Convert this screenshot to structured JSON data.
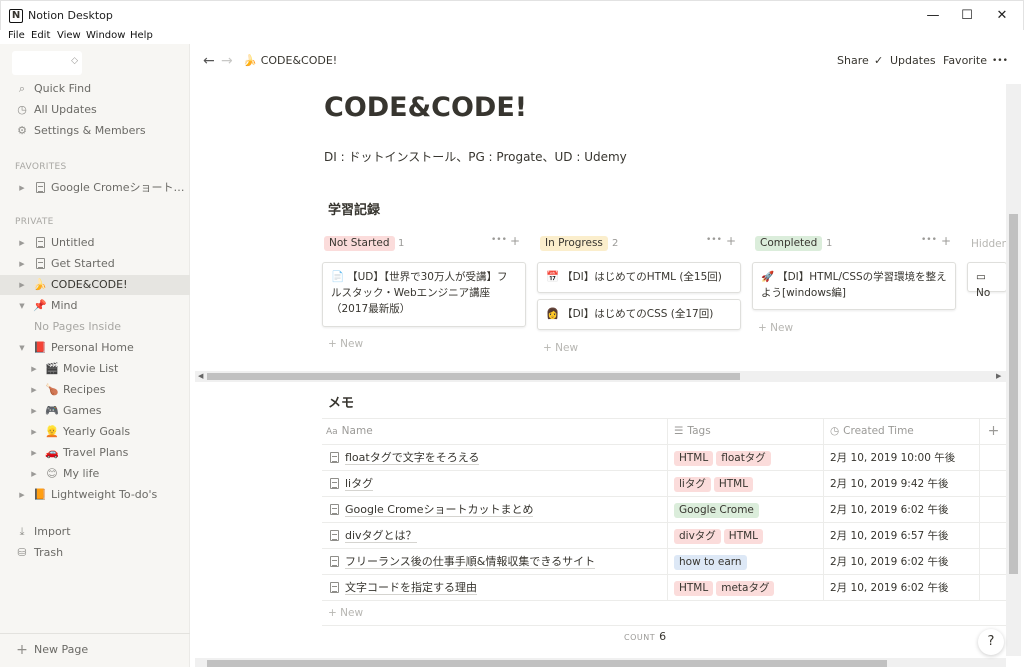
{
  "window": {
    "title": "Notion Desktop",
    "app_icon": "N",
    "minimize": "—",
    "maximize": "☐",
    "close": "✕"
  },
  "menu": [
    "File",
    "Edit",
    "View",
    "Window",
    "Help"
  ],
  "sidebar": {
    "quick": [
      {
        "label": "Quick Find",
        "icon": "search-icon",
        "glyph": "🔍"
      },
      {
        "label": "All Updates",
        "icon": "clock-icon",
        "glyph": "🕒"
      },
      {
        "label": "Settings & Members",
        "icon": "gear-icon",
        "glyph": "⚙"
      }
    ],
    "favorites_heading": "FAVORITES",
    "favorites": [
      {
        "label": "Google Cromeショート…",
        "icon": "page-icon"
      }
    ],
    "private_heading": "PRIVATE",
    "pages": [
      {
        "label": "Untitled",
        "icon": "page-icon"
      },
      {
        "label": "Get Started",
        "icon": "page-icon"
      },
      {
        "label": "CODE&CODE!",
        "icon": "banana-icon",
        "glyph": "🍌"
      },
      {
        "label": "Mind",
        "icon": "pushpin-icon",
        "glyph": "📌"
      },
      {
        "label": "No Pages Inside"
      },
      {
        "label": "Personal Home",
        "icon": "book-icon",
        "glyph": "📕"
      },
      {
        "label": "Movie List",
        "icon": "clapper-icon",
        "glyph": "🎬"
      },
      {
        "label": "Recipes",
        "icon": "drumstick-icon",
        "glyph": "🍗"
      },
      {
        "label": "Games",
        "icon": "gamepad-icon",
        "glyph": "🎮"
      },
      {
        "label": "Yearly Goals",
        "icon": "person-icon",
        "glyph": "👱"
      },
      {
        "label": "Travel Plans",
        "icon": "car-icon",
        "glyph": "🚗"
      },
      {
        "label": "My life",
        "icon": "smiley-icon",
        "glyph": "😊"
      },
      {
        "label": "Lightweight To-do's",
        "icon": "red-book-icon",
        "glyph": "📙"
      }
    ],
    "bottom": [
      {
        "label": "Import",
        "icon": "import-icon",
        "glyph": "⤓"
      },
      {
        "label": "Trash",
        "icon": "trash-icon",
        "glyph": "🗑"
      }
    ],
    "new_page": "New Page",
    "new_page_glyph": "+"
  },
  "topbar": {
    "back": "←",
    "forward": "→",
    "breadcrumb": "CODE&CODE!",
    "breadcrumb_glyph": "🍌",
    "share": "Share",
    "updates": "Updates",
    "updates_check": "✓",
    "favorite": "Favorite",
    "more": "•••"
  },
  "page": {
    "title": "CODE&CODE!",
    "description": "DI : ドットインストール、PG : Progate、UD : Udemy"
  },
  "board": {
    "title": "学習記録",
    "columns": [
      {
        "label": "Not Started",
        "count": "1",
        "color": "#fbdcdb",
        "cards": [
          {
            "glyph": "📄",
            "text": "【UD】【世界で30万人が受講】フルスタック・Webエンジニア講座（2017最新版）"
          }
        ]
      },
      {
        "label": "In Progress",
        "count": "2",
        "color": "#fbeecc",
        "cards": [
          {
            "glyph": "📅",
            "text": "【DI】はじめてのHTML (全15回)"
          },
          {
            "glyph": "👩",
            "text": "【DI】はじめてのCSS (全17回)"
          }
        ]
      },
      {
        "label": "Completed",
        "count": "1",
        "color": "#dbeddb",
        "cards": [
          {
            "glyph": "🚀",
            "text": "【DI】HTML/CSSの学習環境を整えよう[windows編]"
          }
        ]
      }
    ],
    "hidden_label": "Hidden",
    "hidden_card": "No",
    "new_label": "New",
    "more": "•••",
    "plus": "+"
  },
  "table": {
    "title": "メモ",
    "columns": [
      {
        "label": "Name",
        "glyph": "Aa"
      },
      {
        "label": "Tags",
        "glyph": "☰"
      },
      {
        "label": "Created Time",
        "glyph": "🕒"
      }
    ],
    "add_column": "+",
    "rows": [
      {
        "name": "floatタグで文字をそろえる",
        "tags": [
          {
            "t": "HTML",
            "c": "#fbdcdb"
          },
          {
            "t": "floatタグ",
            "c": "#fbdcdb"
          }
        ],
        "time": "2月 10, 2019 10:00 午後"
      },
      {
        "name": "liタグ",
        "tags": [
          {
            "t": "liタグ",
            "c": "#fbdcdb"
          },
          {
            "t": "HTML",
            "c": "#fbdcdb"
          }
        ],
        "time": "2月 10, 2019 9:42 午後"
      },
      {
        "name": "Google Cromeショートカットまとめ",
        "tags": [
          {
            "t": "Google Crome",
            "c": "#dbeddb"
          }
        ],
        "time": "2月 10, 2019 6:02 午後"
      },
      {
        "name": "divタグとは？",
        "tags": [
          {
            "t": "divタグ",
            "c": "#fbdcdb"
          },
          {
            "t": "HTML",
            "c": "#fbdcdb"
          }
        ],
        "time": "2月 10, 2019 6:57 午後"
      },
      {
        "name": "フリーランス後の仕事手順&情報収集できるサイト",
        "tags": [
          {
            "t": "how to earn",
            "c": "#dde8f6"
          }
        ],
        "time": "2月 10, 2019 6:02 午後"
      },
      {
        "name": "文字コードを指定する理由",
        "tags": [
          {
            "t": "HTML",
            "c": "#fbdcdb"
          },
          {
            "t": "metaタグ",
            "c": "#fbdcdb"
          }
        ],
        "time": "2月 10, 2019 6:02 午後"
      }
    ],
    "new_label": "New",
    "count_label": "COUNT",
    "count_value": "6"
  },
  "help": "?"
}
